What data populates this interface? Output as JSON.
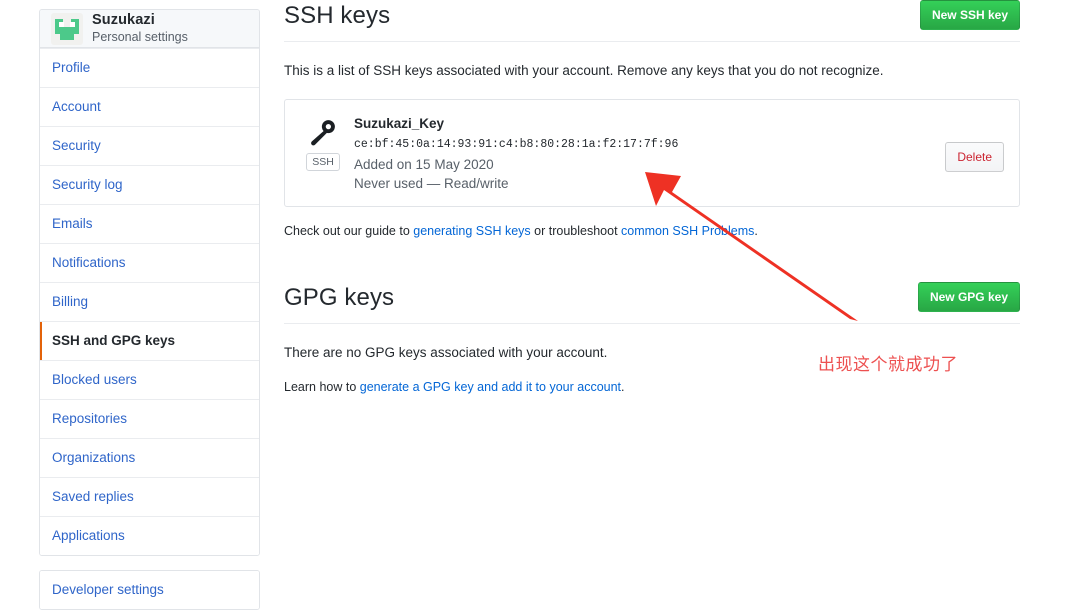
{
  "sidebar": {
    "profile": {
      "name": "Suzukazi",
      "subtitle": "Personal settings",
      "avatar_icon": "identicon-avatar"
    },
    "items": [
      {
        "label": "Profile",
        "selected": false
      },
      {
        "label": "Account",
        "selected": false
      },
      {
        "label": "Security",
        "selected": false
      },
      {
        "label": "Security log",
        "selected": false
      },
      {
        "label": "Emails",
        "selected": false
      },
      {
        "label": "Notifications",
        "selected": false
      },
      {
        "label": "Billing",
        "selected": false
      },
      {
        "label": "SSH and GPG keys",
        "selected": true
      },
      {
        "label": "Blocked users",
        "selected": false
      },
      {
        "label": "Repositories",
        "selected": false
      },
      {
        "label": "Organizations",
        "selected": false
      },
      {
        "label": "Saved replies",
        "selected": false
      },
      {
        "label": "Applications",
        "selected": false
      }
    ],
    "developer_settings": "Developer settings",
    "selected_accent_color": "#e36209"
  },
  "ssh_section": {
    "title": "SSH keys",
    "new_button": "New SSH key",
    "description": "This is a list of SSH keys associated with your account. Remove any keys that you do not recognize.",
    "key": {
      "icon": "key-icon",
      "badge": "SSH",
      "title": "Suzukazi_Key",
      "fingerprint": "ce:bf:45:0a:14:93:91:c4:b8:80:28:1a:f2:17:7f:96",
      "added": "Added on 15 May 2020",
      "usage": "Never used — Read/write",
      "delete_button": "Delete"
    },
    "footnote": {
      "part1": "Check out our guide to ",
      "link1": "generating SSH keys",
      "part2": " or troubleshoot ",
      "link2": "common SSH Problems",
      "part3": "."
    }
  },
  "gpg_section": {
    "title": "GPG keys",
    "new_button": "New GPG key",
    "empty_message": "There are no GPG keys associated with your account.",
    "learn": {
      "part1": "Learn how to ",
      "link": "generate a GPG key and add it to your account",
      "part2": "."
    }
  },
  "annotation": {
    "text": "出现这个就成功了",
    "color": "#ed5050",
    "arrow": "red-arrow"
  },
  "colors": {
    "green_button": "#2cbe4e",
    "link": "#0366d6",
    "delete_text": "#cb2431",
    "accent_orange": "#e36209"
  }
}
